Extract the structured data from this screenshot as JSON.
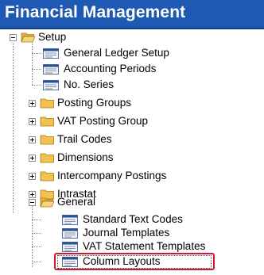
{
  "header": {
    "title": "Financial Management"
  },
  "tree": {
    "setup": {
      "label": "Setup",
      "children": [
        "General Ledger Setup",
        "Accounting Periods",
        "No. Series"
      ],
      "groups": [
        "Posting Groups",
        "VAT Posting Group",
        "Trail Codes",
        "Dimensions",
        "Intercompany Postings",
        "Intrastat"
      ],
      "general": {
        "label": "General",
        "children": [
          "Standard Text Codes",
          "Journal Templates",
          "VAT Statement Templates",
          "Column Layouts"
        ]
      }
    }
  },
  "colors": {
    "header_bg": "#1e5ab4",
    "highlight": "#d4172f",
    "folder": "#f2c14e"
  }
}
